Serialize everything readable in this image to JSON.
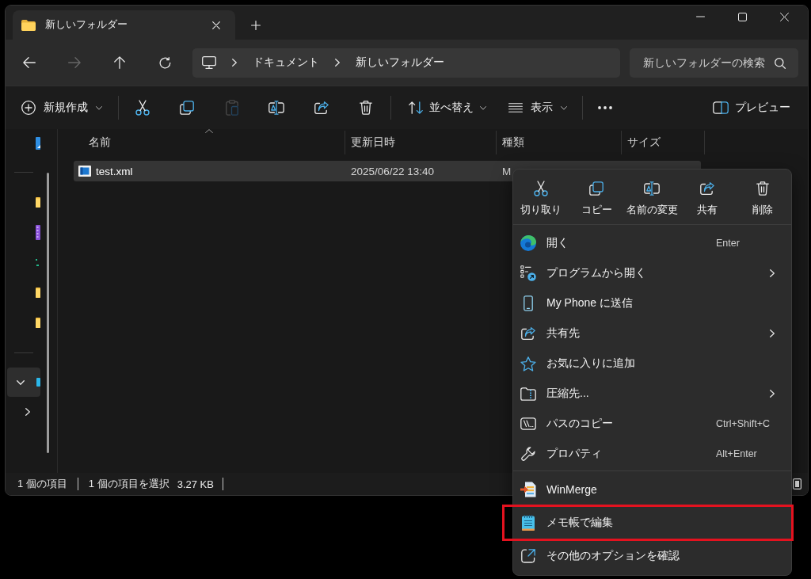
{
  "window": {
    "tabs": [
      {
        "title": "新しいフォルダー",
        "selected": true
      }
    ]
  },
  "nav_buttons": [
    {
      "kind": "back",
      "disabled": false
    },
    {
      "kind": "forward",
      "disabled": true
    },
    {
      "kind": "up",
      "disabled": false
    },
    {
      "kind": "refresh",
      "disabled": false
    }
  ],
  "address": {
    "segments": [
      "ドキュメント",
      "新しいフォルダー"
    ]
  },
  "search": {
    "placeholder": "新しいフォルダーの検索"
  },
  "toolbar": {
    "new_label": "新規作成",
    "actions": [
      {
        "kind": "cut",
        "disabled": false
      },
      {
        "kind": "copy",
        "disabled": false
      },
      {
        "kind": "paste",
        "disabled": true
      },
      {
        "kind": "rename",
        "disabled": false
      },
      {
        "kind": "share",
        "disabled": false
      },
      {
        "kind": "delete",
        "disabled": false
      }
    ],
    "sort_label": "並べ替え",
    "view_label": "表示",
    "preview_label": "プレビュー"
  },
  "sidebar": {
    "pinned": [
      {
        "kind": "drive"
      }
    ],
    "quick_access": [
      {
        "kind": "folder"
      },
      {
        "kind": "videos"
      },
      {
        "kind": "music"
      },
      {
        "kind": "folder"
      },
      {
        "kind": "folder"
      }
    ],
    "tree": [
      {
        "kind": "pc",
        "expanded": true,
        "selected": true,
        "children": [
          {
            "expanded": false,
            "selected": false
          }
        ]
      }
    ]
  },
  "table": {
    "columns": [
      {
        "label": "名前",
        "sorted": true
      },
      {
        "label": "更新日時",
        "sorted": false
      },
      {
        "label": "種類",
        "sorted": false
      },
      {
        "label": "サイズ",
        "sorted": false
      }
    ],
    "rows": [
      {
        "name": "test.xml",
        "modified": "2025/06/22 13:40",
        "type": "M",
        "selected": true
      }
    ]
  },
  "status_bar": {
    "item_count": "1 個の項目",
    "selection": "1 個の項目を選択",
    "selection_size": "3.27 KB"
  },
  "context_menu": {
    "quick_actions": [
      {
        "kind": "cut",
        "label": "切り取り"
      },
      {
        "kind": "copy",
        "label": "コピー"
      },
      {
        "kind": "rename",
        "label": "名前の変更"
      },
      {
        "kind": "share",
        "label": "共有"
      },
      {
        "kind": "delete",
        "label": "削除"
      }
    ],
    "sections": [
      {
        "items": [
          {
            "kind": "edge",
            "label": "開く",
            "shortcut": "Enter",
            "submenu": false,
            "highlighted": false
          },
          {
            "kind": "open_with",
            "label": "プログラムから開く",
            "submenu": true,
            "highlighted": false
          },
          {
            "kind": "phone",
            "label": "My Phone に送信",
            "submenu": false,
            "highlighted": false
          },
          {
            "kind": "share",
            "label": "共有先",
            "submenu": true,
            "highlighted": false
          },
          {
            "kind": "star",
            "label": "お気に入りに追加",
            "submenu": false,
            "highlighted": false
          },
          {
            "kind": "zip",
            "label": "圧縮先...",
            "submenu": true,
            "highlighted": false
          },
          {
            "kind": "path",
            "label": "パスのコピー",
            "shortcut": "Ctrl+Shift+C",
            "submenu": false,
            "highlighted": false
          },
          {
            "kind": "wrench",
            "label": "プロパティ",
            "shortcut": "Alt+Enter",
            "submenu": false,
            "highlighted": false
          }
        ]
      },
      {
        "items": [
          {
            "kind": "winmerge",
            "label": "WinMerge",
            "submenu": false,
            "highlighted": false
          },
          {
            "kind": "notepad",
            "label": "メモ帳で編集",
            "submenu": false,
            "highlighted": true
          },
          {
            "kind": "more",
            "label": "その他のオプションを確認",
            "submenu": false,
            "highlighted": false
          }
        ]
      }
    ]
  }
}
